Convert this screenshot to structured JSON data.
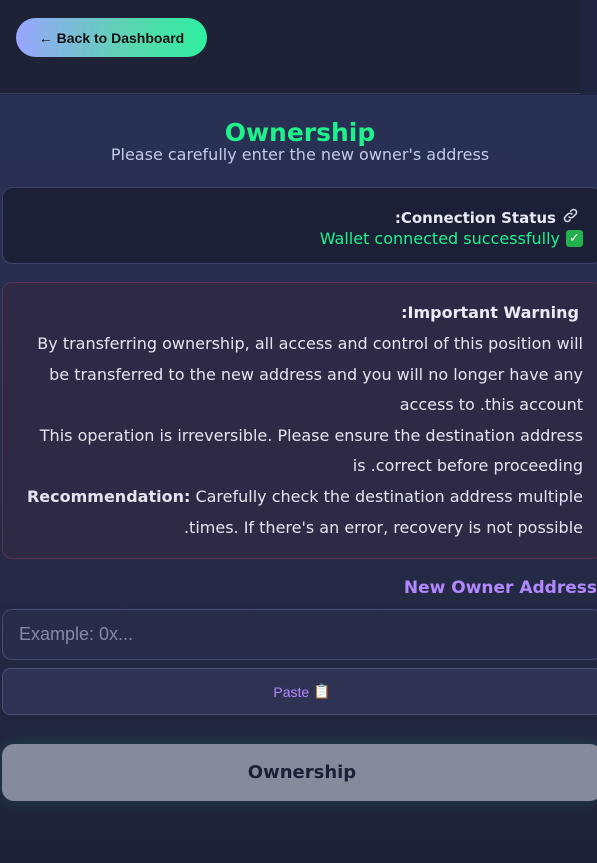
{
  "header": {
    "back_label": "← Back to Dashboard"
  },
  "page": {
    "title": "Ownership",
    "subtitle": "Please carefully enter the new owner's address"
  },
  "status": {
    "title": ":Connection Status",
    "icon": "link-icon",
    "message": "Wallet connected successfully",
    "check_icon": "check-icon",
    "check_glyph": "✓"
  },
  "warning": {
    "title": ":Important Warning",
    "p1": "By transferring ownership, all access and control of this position will be transferred to the new address and you will no longer have any access to .this account",
    "p2": "This operation is irreversible. Please ensure the destination address is .correct before proceeding",
    "rec_label": "Recommendation:",
    "rec_text": " Carefully check the destination address multiple .times. If there's an error, recovery is not possible"
  },
  "form": {
    "label": "New Owner Address",
    "placeholder": "Example: 0x...",
    "paste_label": "Paste",
    "paste_icon": "clipboard-icon",
    "paste_glyph": "📋",
    "submit_label": "Ownership"
  },
  "colors": {
    "accent_green": "#1ff28a",
    "accent_purple": "#b389ff",
    "background": "#1f2440"
  }
}
